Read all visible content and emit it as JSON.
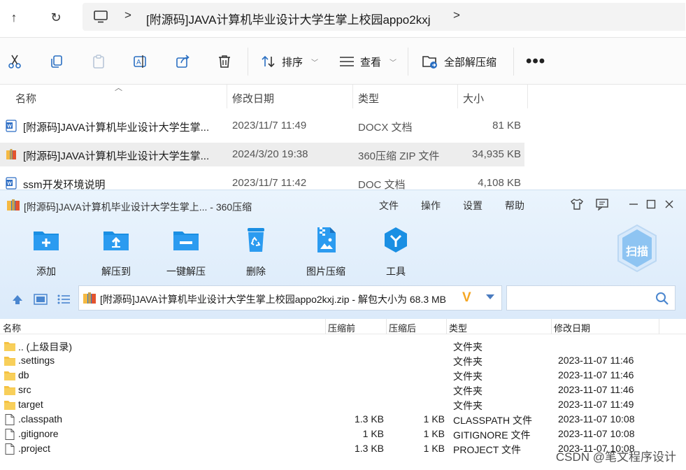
{
  "explorer": {
    "nav": {
      "back": "↑",
      "refresh": "↻"
    },
    "address": {
      "sep1": ">",
      "path": "[附源码]JAVA计算机毕业设计大学生掌上校园appo2kxj",
      "sep2": ">"
    },
    "toolbar": {
      "icons": [
        "cut-icon",
        "copy-icon",
        "paste-icon",
        "rename-icon",
        "share-icon",
        "delete-icon"
      ],
      "sort_label": "排序",
      "view_label": "查看",
      "extract_all_label": "全部解压缩",
      "more_label": "•••"
    },
    "columns": {
      "name": "名称",
      "date": "修改日期",
      "type": "类型",
      "size": "大小"
    },
    "files": [
      {
        "name": "[附源码]JAVA计算机毕业设计大学生掌...",
        "date": "2023/11/7 11:49",
        "type": "DOCX 文档",
        "size": "81 KB",
        "icon": "word"
      },
      {
        "name": "[附源码]JAVA计算机毕业设计大学生掌...",
        "date": "2024/3/20 19:38",
        "type": "360压缩 ZIP 文件",
        "size": "34,935 KB",
        "icon": "zip"
      },
      {
        "name": "ssm开发环境说明",
        "date": "2023/11/7 11:42",
        "type": "DOC 文档",
        "size": "4,108 KB",
        "icon": "word"
      }
    ]
  },
  "zip360": {
    "title": "[附源码]JAVA计算机毕业设计大学生掌上... - 360压缩",
    "menu": [
      "文件",
      "操作",
      "设置",
      "帮助"
    ],
    "tools": [
      "添加",
      "解压到",
      "一键解压",
      "删除",
      "图片压缩",
      "工具"
    ],
    "scan_label": "扫描",
    "archive_text": "[附源码]JAVA计算机毕业设计大学生掌上校园appo2kxj.zip - 解包大小为 68.3 MB",
    "v_mark": "V",
    "search_placeholder": "",
    "columns": {
      "name": "名称",
      "before": "压缩前",
      "after": "压缩后",
      "type": "类型",
      "date": "修改日期"
    },
    "rows": [
      {
        "name": ".. (上级目录)",
        "before": "",
        "after": "",
        "type": "文件夹",
        "date": "",
        "icon": "folder"
      },
      {
        "name": ".settings",
        "before": "",
        "after": "",
        "type": "文件夹",
        "date": "2023-11-07 11:46",
        "icon": "folder"
      },
      {
        "name": "db",
        "before": "",
        "after": "",
        "type": "文件夹",
        "date": "2023-11-07 11:46",
        "icon": "folder"
      },
      {
        "name": "src",
        "before": "",
        "after": "",
        "type": "文件夹",
        "date": "2023-11-07 11:46",
        "icon": "folder"
      },
      {
        "name": "target",
        "before": "",
        "after": "",
        "type": "文件夹",
        "date": "2023-11-07 11:49",
        "icon": "folder"
      },
      {
        "name": ".classpath",
        "before": "1.3 KB",
        "after": "1 KB",
        "type": "CLASSPATH 文件",
        "date": "2023-11-07 10:08",
        "icon": "file"
      },
      {
        "name": ".gitignore",
        "before": "1 KB",
        "after": "1 KB",
        "type": "GITIGNORE 文件",
        "date": "2023-11-07 10:08",
        "icon": "file"
      },
      {
        "name": ".project",
        "before": "1.3 KB",
        "after": "1 KB",
        "type": "PROJECT 文件",
        "date": "2023-11-07 10:08",
        "icon": "file"
      }
    ],
    "watermark": "CSDN @笔文程序设计"
  },
  "colors": {
    "accent": "#1a8fe3",
    "folder": "#f5c242",
    "zip_bar": "#dbeafa",
    "word": "#2b6cc4"
  }
}
